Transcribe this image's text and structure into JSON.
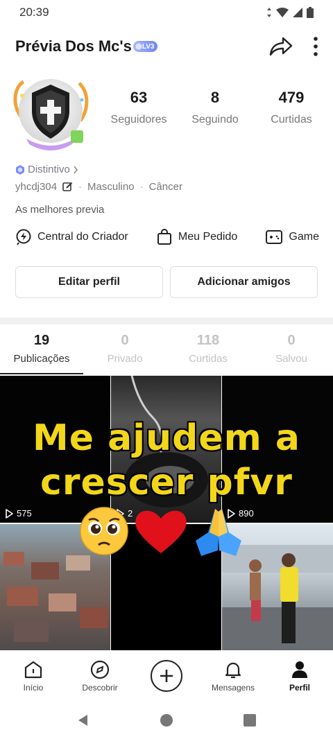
{
  "status_bar": {
    "time": "20:39"
  },
  "header": {
    "title": "Prévia Dos Mc's",
    "level": "LV3"
  },
  "stats": [
    {
      "value": "63",
      "label": "Seguidores"
    },
    {
      "value": "8",
      "label": "Seguindo"
    },
    {
      "value": "479",
      "label": "Curtidas"
    }
  ],
  "bio": {
    "badge": "Distintivo",
    "username": "yhcdj304",
    "gender": "Masculino",
    "sign": "Câncer",
    "description": "As melhores previa"
  },
  "shortcuts": [
    {
      "label": "Central do Criador",
      "icon": "creator-bolt-icon"
    },
    {
      "label": "Meu Pedido",
      "icon": "shopping-bag-icon"
    },
    {
      "label": "Game",
      "icon": "gamepad-icon"
    }
  ],
  "buttons": {
    "edit": "Editar perfil",
    "add_friends": "Adicionar amigos"
  },
  "tabs": [
    {
      "count": "19",
      "label": "Publicações",
      "active": true
    },
    {
      "count": "0",
      "label": "Privado"
    },
    {
      "count": "118",
      "label": "Curtidas"
    },
    {
      "count": "0",
      "label": "Salvou"
    }
  ],
  "posts": [
    {
      "views": "575"
    },
    {
      "views": "2"
    },
    {
      "views": "890"
    },
    {
      "views": ""
    },
    {
      "views": ""
    },
    {
      "views": ""
    }
  ],
  "overlay": {
    "line1": "Me ajudem a",
    "line2": "crescer pfvr"
  },
  "bottom_nav": [
    {
      "label": "Início"
    },
    {
      "label": "Descobrir"
    },
    {
      "label": ""
    },
    {
      "label": "Mensagens"
    },
    {
      "label": "Perfil"
    }
  ],
  "colors": {
    "overlay_text": "#f2d61a",
    "level_badge": "#7d8ff7",
    "distintivo_icon": "#7b8ff5"
  }
}
